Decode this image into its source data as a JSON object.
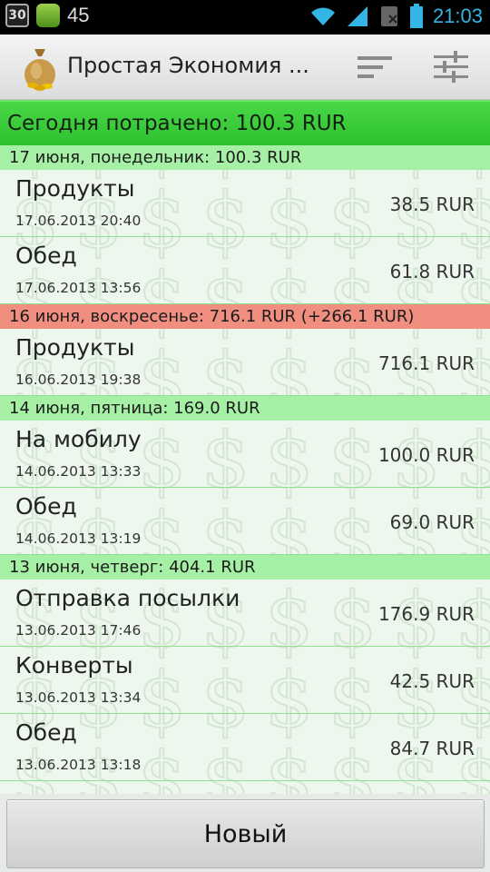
{
  "status_bar": {
    "badge": "30",
    "count": "45",
    "time": "21:03",
    "icons": [
      "notification-30-icon",
      "app-notification-icon",
      "wifi-icon",
      "signal-icon",
      "no-sim-icon",
      "battery-icon"
    ]
  },
  "action_bar": {
    "title": "Простая Экономия ...",
    "icons": [
      "money-bag-icon",
      "sort-icon",
      "settings-sliders-icon"
    ]
  },
  "summary": "Сегодня потрачено: 100.3 RUR",
  "days": [
    {
      "header": "17 июня, понедельник: 100.3 RUR",
      "status": "green",
      "items": [
        {
          "name": "Продукты",
          "date": "17.06.2013 20:40",
          "amount": "38.5 RUR"
        },
        {
          "name": "Обед",
          "date": "17.06.2013 13:56",
          "amount": "61.8 RUR"
        }
      ]
    },
    {
      "header": "16 июня, воскресенье: 716.1 RUR (+266.1 RUR)",
      "status": "red",
      "items": [
        {
          "name": "Продукты",
          "date": "16.06.2013 19:38",
          "amount": "716.1 RUR"
        }
      ]
    },
    {
      "header": "14 июня, пятница: 169.0 RUR",
      "status": "green",
      "items": [
        {
          "name": "На мобилу",
          "date": "14.06.2013 13:33",
          "amount": "100.0 RUR"
        },
        {
          "name": "Обед",
          "date": "14.06.2013 13:19",
          "amount": "69.0 RUR"
        }
      ]
    },
    {
      "header": "13 июня, четверг: 404.1 RUR",
      "status": "green",
      "items": [
        {
          "name": "Отправка посылки",
          "date": "13.06.2013 17:46",
          "amount": "176.9 RUR"
        },
        {
          "name": "Конверты",
          "date": "13.06.2013 13:34",
          "amount": "42.5 RUR"
        },
        {
          "name": "Обед",
          "date": "13.06.2013 13:18",
          "amount": "84.7 RUR"
        }
      ]
    }
  ],
  "new_button": "Новый",
  "colors": {
    "summary_bg": "#3fcf3f",
    "header_green": "#a5f0a5",
    "header_red": "#f08f80",
    "time_blue": "#33b5e5"
  }
}
